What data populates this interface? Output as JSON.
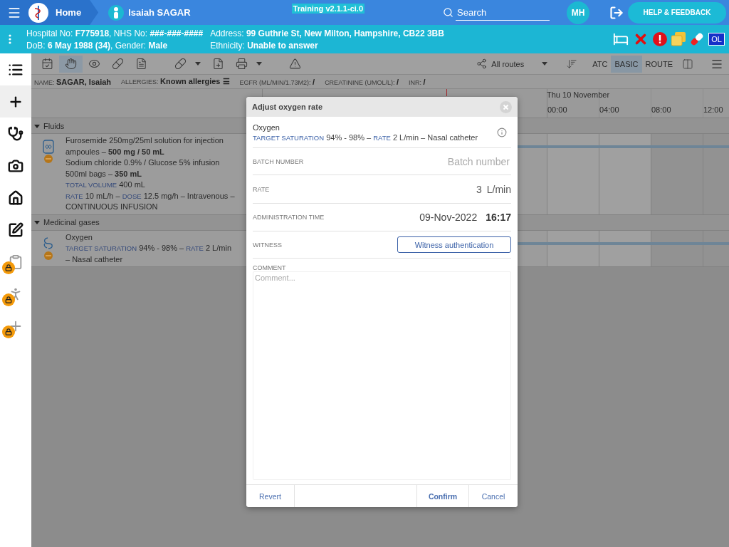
{
  "top_bar": {
    "home": "Home",
    "patient": "Isaiah SAGAR",
    "environment": "Training v2.1.1-ci.0",
    "search": {
      "placeholder": "Search"
    },
    "user_initials": "MH",
    "help_button": "HELP & FEEDBACK"
  },
  "patient_banner": {
    "columns": [
      [
        "Hospital No: **F775918**, NHS No: **###-###-####**",
        "DoB: **6 May 1988 (34)**, Gender: **Male**"
      ],
      [
        "Address: **99 Guthrie St, New Milton, Hampshire, CB22 3BB**",
        "Ethnicity: **Unable to answer**"
      ]
    ],
    "alerts": [
      {
        "kind": "bed"
      },
      {
        "kind": "cross"
      },
      {
        "kind": "warning"
      },
      {
        "kind": "folders"
      },
      {
        "kind": "pill"
      },
      {
        "kind": "badge",
        "label": "OL"
      }
    ]
  },
  "sidebar": {
    "items": [
      {
        "kind": "list",
        "selected": false,
        "locked": false
      },
      {
        "kind": "add",
        "selected": true,
        "locked": false
      },
      {
        "kind": "stethoscope",
        "selected": false,
        "locked": false
      },
      {
        "kind": "camera",
        "selected": false,
        "locked": false
      },
      {
        "kind": "house",
        "selected": false,
        "locked": false
      },
      {
        "kind": "sign",
        "selected": false,
        "locked": false
      },
      {
        "kind": "clipboard",
        "selected": false,
        "locked": true
      },
      {
        "kind": "walk",
        "selected": false,
        "locked": true
      },
      {
        "kind": "add",
        "selected": false,
        "locked": true
      }
    ]
  },
  "toolbar": {
    "tools": [
      {
        "kind": "chart",
        "selected": false,
        "menu": false
      },
      {
        "kind": "administer",
        "selected": true,
        "menu": false
      },
      {
        "kind": "view",
        "selected": false,
        "menu": false
      },
      {
        "kind": "pill",
        "selected": false,
        "menu": false
      },
      {
        "kind": "document",
        "selected": false,
        "menu": false
      },
      {
        "kind": "add_drug",
        "selected": false,
        "menu": true
      },
      {
        "kind": "add_document",
        "selected": false,
        "menu": false
      },
      {
        "kind": "print",
        "selected": false,
        "menu": true
      },
      {
        "kind": "warning",
        "selected": false,
        "menu": false
      }
    ],
    "route_filter": "All routes",
    "views": [
      {
        "label": "ATC",
        "selected": false
      },
      {
        "label": "BASIC",
        "selected": true
      },
      {
        "label": "ROUTE",
        "selected": false
      }
    ]
  },
  "patient_info": [
    {
      "label": "NAME:",
      "value": "SAGAR, Isaiah"
    },
    {
      "label": "ALLERGIES:",
      "value": "Known allergies ☰"
    },
    {
      "label": "EGFR (ML/MIN/1.73M2):",
      "value": "/"
    },
    {
      "label": "CREATININE (UMOL/L):",
      "value": "/"
    },
    {
      "label": "INR:",
      "value": "/"
    }
  ],
  "timeline": {
    "day": "Thu 10 November",
    "hours": [
      "00:00",
      "04:00",
      "08:00",
      "12:00"
    ]
  },
  "groups": [
    {
      "name": "Fluids",
      "expanded": true,
      "items": [
        {
          "kind": "infusion",
          "products": [
            "Furosemide 250mg/25ml solution for injection ampoules – **500 mg / 50 mL**",
            "Sodium chloride 0.9% / Glucose 5% infusion 500ml bags – **350 mL**"
          ],
          "details": [
            [
              {
                "label": "TOTAL VOLUME",
                "text": "400 mL"
              }
            ],
            [
              {
                "label": "RATE",
                "text": "10 mL/h –"
              },
              {
                "label": "DOSE",
                "text": "12.5 mg/h – Intravenous – CONTINUOUS INFUSION"
              }
            ]
          ]
        }
      ]
    },
    {
      "name": "Medicinal gases",
      "expanded": true,
      "items": [
        {
          "kind": "gas",
          "products": [
            "Oxygen"
          ],
          "details": [
            [
              {
                "label": "TARGET SATURATION",
                "text": "94% - 98% –"
              },
              {
                "label": "RATE",
                "text": "2 L/min – Nasal catheter"
              }
            ]
          ]
        }
      ]
    }
  ],
  "dialog": {
    "title": "Adjust oxygen rate",
    "drug": "Oxygen",
    "details": [
      {
        "label": "TARGET SATURATION",
        "text": "94% - 98% –"
      },
      {
        "label": "RATE",
        "text": "2 L/min – Nasal catheter"
      }
    ],
    "batch": {
      "label": "BATCH NUMBER",
      "placeholder": "Batch number"
    },
    "rate": {
      "label": "RATE",
      "value": "3",
      "unit": "L/min"
    },
    "time": {
      "label": "ADMINISTRATION TIME",
      "date": "09-Nov-2022",
      "time": "16:17"
    },
    "witness": {
      "label": "WITNESS",
      "button": "Witness authentication"
    },
    "comment": {
      "label": "COMMENT",
      "placeholder": "Comment..."
    },
    "buttons": {
      "revert": "Revert",
      "confirm": "Confirm",
      "cancel": "Cancel"
    }
  }
}
